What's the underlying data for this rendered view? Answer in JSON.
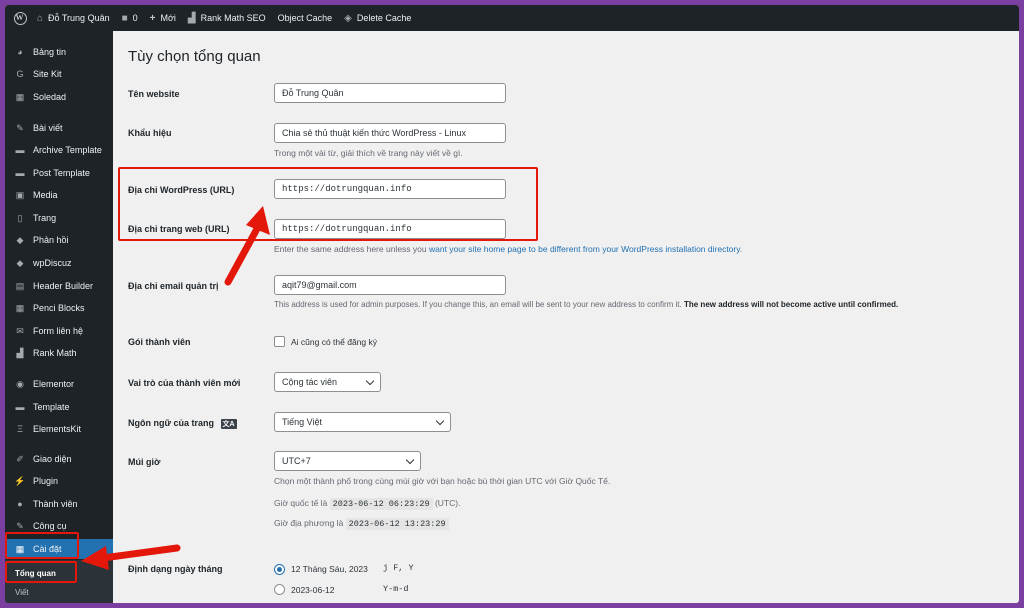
{
  "adminbar": {
    "site_name": "Đỗ Trung Quân",
    "comments_count": "0",
    "new_label": "Mới",
    "items": [
      "Rank Math SEO",
      "Object Cache",
      "Delete Cache"
    ]
  },
  "sidebar": {
    "items": [
      {
        "label": "Bảng tin",
        "icon": "dashboard-icon",
        "glyph": "◕"
      },
      {
        "label": "Site Kit",
        "icon": "google-g-icon",
        "glyph": "G"
      },
      {
        "label": "Soledad",
        "icon": "building-icon",
        "glyph": "▦"
      },
      {
        "label": "Bài viết",
        "icon": "pushpin-icon",
        "glyph": "✎"
      },
      {
        "label": "Archive Template",
        "icon": "template-icon",
        "glyph": "▬"
      },
      {
        "label": "Post Template",
        "icon": "template-icon",
        "glyph": "▬"
      },
      {
        "label": "Media",
        "icon": "media-icon",
        "glyph": "▣"
      },
      {
        "label": "Trang",
        "icon": "page-icon",
        "glyph": "▯"
      },
      {
        "label": "Phản hồi",
        "icon": "comment-icon",
        "glyph": "◆"
      },
      {
        "label": "wpDiscuz",
        "icon": "discuz-icon",
        "glyph": "◆"
      },
      {
        "label": "Header Builder",
        "icon": "header-icon",
        "glyph": "▤"
      },
      {
        "label": "Penci Blocks",
        "icon": "blocks-icon",
        "glyph": "▦"
      },
      {
        "label": "Form liên hệ",
        "icon": "mail-icon",
        "glyph": "✉"
      },
      {
        "label": "Rank Math",
        "icon": "chart-icon",
        "glyph": "▟"
      },
      {
        "label": "Elementor",
        "icon": "elementor-icon",
        "glyph": "◉"
      },
      {
        "label": "Template",
        "icon": "folder-icon",
        "glyph": "▬"
      },
      {
        "label": "ElementsKit",
        "icon": "ek-icon",
        "glyph": "Ξ"
      },
      {
        "label": "Giao diện",
        "icon": "brush-icon",
        "glyph": "✐"
      },
      {
        "label": "Plugin",
        "icon": "plugin-icon",
        "glyph": "⚡"
      },
      {
        "label": "Thành viên",
        "icon": "user-icon",
        "glyph": "●"
      },
      {
        "label": "Công cụ",
        "icon": "wrench-icon",
        "glyph": "✎"
      },
      {
        "label": "Cài đặt",
        "icon": "settings-icon",
        "glyph": "▦"
      }
    ],
    "submenu": [
      "Tổng quan",
      "Viết"
    ]
  },
  "main": {
    "title": "Tùy chọn tổng quan",
    "site_title": {
      "label": "Tên website",
      "value": "Đỗ Trung Quân"
    },
    "tagline": {
      "label": "Khẩu hiệu",
      "value": "Chia sẻ thủ thuật kiến thức WordPress - Linux",
      "desc": "Trong một vài từ, giải thích về trang này viết về gì."
    },
    "wp_url": {
      "label": "Địa chỉ WordPress (URL)",
      "value": "https://dotrungquan.info"
    },
    "site_url": {
      "label": "Địa chỉ trang web (URL)",
      "value": "https://dotrungquan.info",
      "desc_pre": "Enter the same address here unless you ",
      "desc_link": "want your site home page to be different from your WordPress installation directory",
      "desc_post": "."
    },
    "admin_email": {
      "label": "Địa chỉ email quản trị",
      "value": "aqit79@gmail.com",
      "desc": "This address is used for admin purposes. If you change this, an email will be sent to your new address to confirm it. ",
      "desc_bold": "The new address will not become active until confirmed."
    },
    "membership": {
      "label": "Gói thành viên",
      "checkbox_label": "Ai cũng có thể đăng ký",
      "checked": false
    },
    "default_role": {
      "label": "Vai trò của thành viên mới",
      "value": "Cộng tác viên"
    },
    "language": {
      "label": "Ngôn ngữ của trang",
      "value": "Tiếng Việt"
    },
    "timezone": {
      "label": "Múi giờ",
      "value": "UTC+7",
      "desc": "Chọn một thành phố trong cùng múi giờ với bạn hoặc bù thời gian UTC với Giờ Quốc Tế.",
      "utc_pre": "Giờ quốc tế là",
      "utc_value": "2023-06-12 06:23:29",
      "utc_post": "(UTC).",
      "local_pre": "Giờ địa phương là",
      "local_value": "2023-06-12 13:23:29"
    },
    "date_format": {
      "label": "Định dạng ngày tháng",
      "options": [
        {
          "label": "12 Tháng Sáu, 2023",
          "format": "j F, Y",
          "checked": true
        },
        {
          "label": "2023-06-12",
          "format": "Y-m-d",
          "checked": false
        }
      ]
    }
  }
}
